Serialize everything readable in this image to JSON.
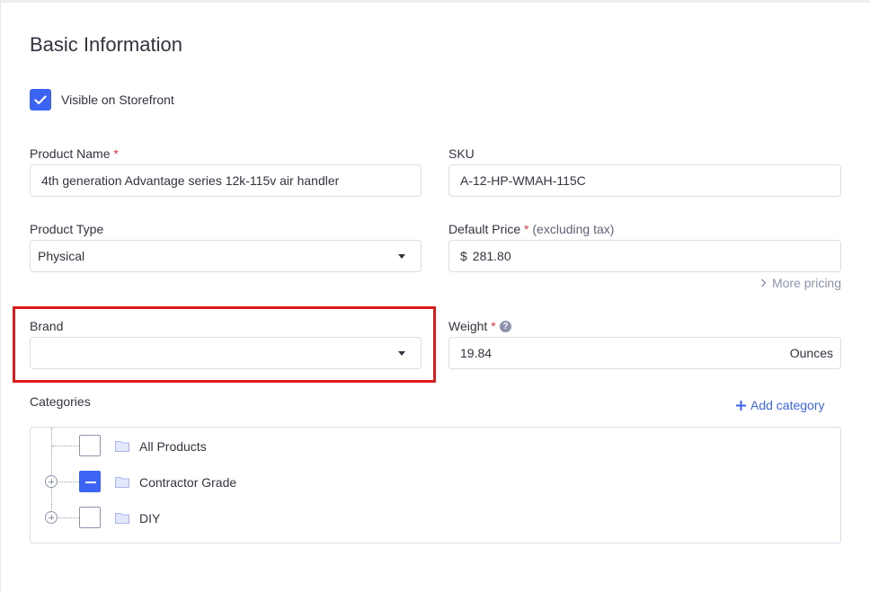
{
  "page": {
    "title": "Basic Information"
  },
  "visibility": {
    "label": "Visible on Storefront",
    "checked": true
  },
  "product_name": {
    "label": "Product Name",
    "required_mark": "*",
    "value": "4th generation Advantage series 12k-115v air handler"
  },
  "sku": {
    "label": "SKU",
    "value": "A-12-HP-WMAH-115C"
  },
  "product_type": {
    "label": "Product Type",
    "value": "Physical"
  },
  "default_price": {
    "label": "Default Price",
    "required_mark": "*",
    "note": "(excluding tax)",
    "currency": "$",
    "value": "281.80",
    "more_pricing": "More pricing"
  },
  "brand": {
    "label": "Brand",
    "value": ""
  },
  "weight": {
    "label": "Weight",
    "required_mark": "*",
    "help": "?",
    "value": "19.84",
    "unit": "Ounces"
  },
  "categories": {
    "label": "Categories",
    "add_label": "Add category",
    "items": [
      {
        "label": "All Products",
        "state": "unchecked",
        "expandable": false
      },
      {
        "label": "Contractor Grade",
        "state": "partial",
        "expandable": true
      },
      {
        "label": "DIY",
        "state": "unchecked",
        "expandable": true
      }
    ]
  },
  "colors": {
    "accent": "#3c64f4",
    "required": "#db3643",
    "highlight": "#d91d1d"
  }
}
